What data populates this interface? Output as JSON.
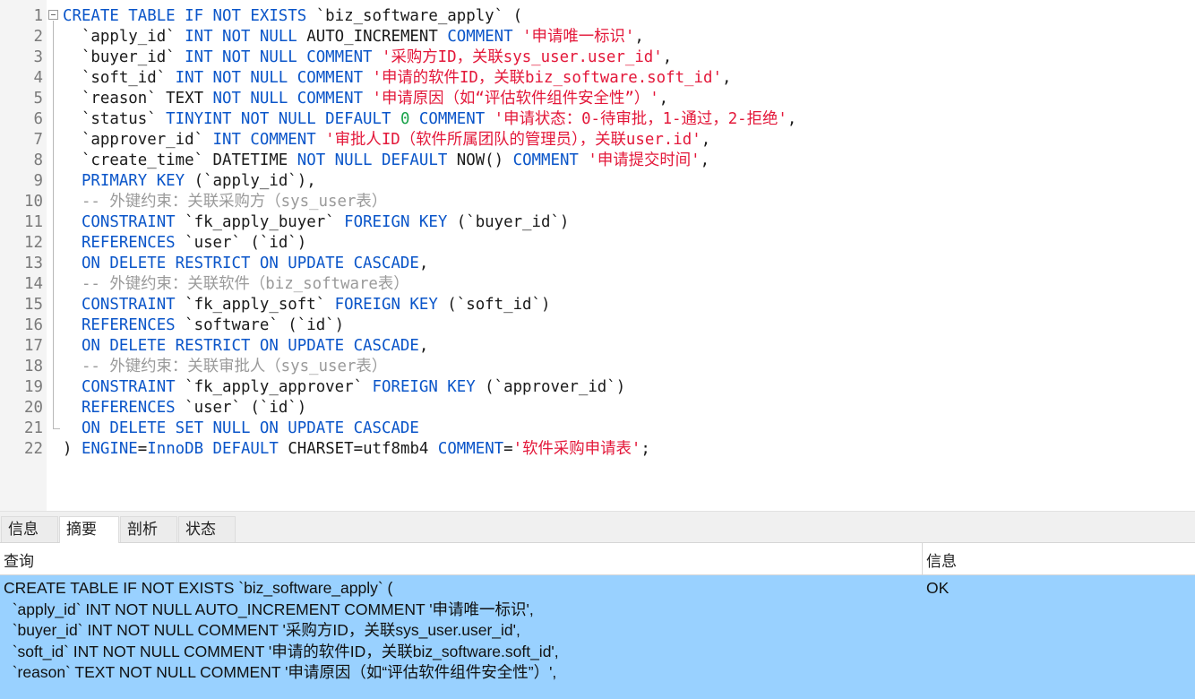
{
  "editor": {
    "lines": [
      {
        "n": "1",
        "tokens": [
          [
            "kw",
            "CREATE TABLE IF NOT EXISTS "
          ],
          [
            "id",
            "`biz_software_apply` ("
          ]
        ]
      },
      {
        "n": "2",
        "tokens": [
          [
            "id",
            "  `apply_id` "
          ],
          [
            "kw",
            "INT NOT NULL "
          ],
          [
            "id",
            "AUTO_INCREMENT "
          ],
          [
            "kw",
            "COMMENT "
          ],
          [
            "str",
            "'申请唯一标识'"
          ],
          [
            "id",
            ","
          ]
        ]
      },
      {
        "n": "3",
        "tokens": [
          [
            "id",
            "  `buyer_id` "
          ],
          [
            "kw",
            "INT NOT NULL COMMENT "
          ],
          [
            "str",
            "'采购方ID，关联sys_user.user_id'"
          ],
          [
            "id",
            ","
          ]
        ]
      },
      {
        "n": "4",
        "tokens": [
          [
            "id",
            "  `soft_id` "
          ],
          [
            "kw",
            "INT NOT NULL COMMENT "
          ],
          [
            "str",
            "'申请的软件ID，关联biz_software.soft_id'"
          ],
          [
            "id",
            ","
          ]
        ]
      },
      {
        "n": "5",
        "tokens": [
          [
            "id",
            "  `reason` TEXT "
          ],
          [
            "kw",
            "NOT NULL COMMENT "
          ],
          [
            "str",
            "'申请原因（如“评估软件组件安全性”）'"
          ],
          [
            "id",
            ","
          ]
        ]
      },
      {
        "n": "6",
        "tokens": [
          [
            "id",
            "  `status` "
          ],
          [
            "kw",
            "TINYINT NOT NULL DEFAULT "
          ],
          [
            "num",
            "0"
          ],
          [
            "kw",
            " COMMENT "
          ],
          [
            "str",
            "'申请状态：0-待审批，1-通过，2-拒绝'"
          ],
          [
            "id",
            ","
          ]
        ]
      },
      {
        "n": "7",
        "tokens": [
          [
            "id",
            "  `approver_id` "
          ],
          [
            "kw",
            "INT COMMENT "
          ],
          [
            "str",
            "'审批人ID（软件所属团队的管理员），关联user.id'"
          ],
          [
            "id",
            ","
          ]
        ]
      },
      {
        "n": "8",
        "tokens": [
          [
            "id",
            "  `create_time` DATETIME "
          ],
          [
            "kw",
            "NOT NULL DEFAULT "
          ],
          [
            "id",
            "NOW() "
          ],
          [
            "kw",
            "COMMENT "
          ],
          [
            "str",
            "'申请提交时间'"
          ],
          [
            "id",
            ","
          ]
        ]
      },
      {
        "n": "9",
        "tokens": [
          [
            "id",
            "  "
          ],
          [
            "kw",
            "PRIMARY KEY "
          ],
          [
            "id",
            "(`apply_id`),"
          ]
        ]
      },
      {
        "n": "10",
        "tokens": [
          [
            "cm",
            "  -- 外键约束：关联采购方（sys_user表）"
          ]
        ]
      },
      {
        "n": "11",
        "tokens": [
          [
            "id",
            "  "
          ],
          [
            "kw",
            "CONSTRAINT "
          ],
          [
            "id",
            "`fk_apply_buyer` "
          ],
          [
            "kw",
            "FOREIGN KEY "
          ],
          [
            "id",
            "(`buyer_id`)"
          ]
        ]
      },
      {
        "n": "12",
        "tokens": [
          [
            "id",
            "  "
          ],
          [
            "kw",
            "REFERENCES "
          ],
          [
            "id",
            "`user` (`id`)"
          ]
        ]
      },
      {
        "n": "13",
        "tokens": [
          [
            "id",
            "  "
          ],
          [
            "kw",
            "ON DELETE RESTRICT ON UPDATE CASCADE"
          ],
          [
            "id",
            ","
          ]
        ]
      },
      {
        "n": "14",
        "tokens": [
          [
            "cm",
            "  -- 外键约束：关联软件（biz_software表）"
          ]
        ]
      },
      {
        "n": "15",
        "tokens": [
          [
            "id",
            "  "
          ],
          [
            "kw",
            "CONSTRAINT "
          ],
          [
            "id",
            "`fk_apply_soft` "
          ],
          [
            "kw",
            "FOREIGN KEY "
          ],
          [
            "id",
            "(`soft_id`)"
          ]
        ]
      },
      {
        "n": "16",
        "tokens": [
          [
            "id",
            "  "
          ],
          [
            "kw",
            "REFERENCES "
          ],
          [
            "id",
            "`software` (`id`)"
          ]
        ]
      },
      {
        "n": "17",
        "tokens": [
          [
            "id",
            "  "
          ],
          [
            "kw",
            "ON DELETE RESTRICT ON UPDATE CASCADE"
          ],
          [
            "id",
            ","
          ]
        ]
      },
      {
        "n": "18",
        "tokens": [
          [
            "cm",
            "  -- 外键约束：关联审批人（sys_user表）"
          ]
        ]
      },
      {
        "n": "19",
        "tokens": [
          [
            "id",
            "  "
          ],
          [
            "kw",
            "CONSTRAINT "
          ],
          [
            "id",
            "`fk_apply_approver` "
          ],
          [
            "kw",
            "FOREIGN KEY "
          ],
          [
            "id",
            "(`approver_id`)"
          ]
        ]
      },
      {
        "n": "20",
        "tokens": [
          [
            "id",
            "  "
          ],
          [
            "kw",
            "REFERENCES "
          ],
          [
            "id",
            "`user` (`id`)"
          ]
        ]
      },
      {
        "n": "21",
        "tokens": [
          [
            "id",
            "  "
          ],
          [
            "kw",
            "ON DELETE SET NULL ON UPDATE CASCADE"
          ]
        ]
      },
      {
        "n": "22",
        "tokens": [
          [
            "id",
            ") "
          ],
          [
            "kw",
            "ENGINE"
          ],
          [
            "id",
            "="
          ],
          [
            "kw",
            "InnoDB DEFAULT "
          ],
          [
            "id",
            "CHARSET=utf8mb4 "
          ],
          [
            "kw",
            "COMMENT"
          ],
          [
            "id",
            "="
          ],
          [
            "str",
            "'软件采购申请表'"
          ],
          [
            "id",
            ";"
          ]
        ]
      }
    ]
  },
  "colors": {
    "keyword": "#0a55c9",
    "string": "#e3183a",
    "number": "#1aa34a",
    "comment": "#9a9a9a",
    "selected_row": "#99d1ff"
  },
  "tabs": [
    {
      "label": "信息",
      "active": false
    },
    {
      "label": "摘要",
      "active": true
    },
    {
      "label": "剖析",
      "active": false
    },
    {
      "label": "状态",
      "active": false
    }
  ],
  "result": {
    "columns": {
      "query": "查询",
      "info": "信息"
    },
    "query_lines": [
      "CREATE TABLE IF NOT EXISTS `biz_software_apply` (",
      "  `apply_id` INT NOT NULL AUTO_INCREMENT COMMENT '申请唯一标识',",
      "  `buyer_id` INT NOT NULL COMMENT '采购方ID，关联sys_user.user_id',",
      "  `soft_id` INT NOT NULL COMMENT '申请的软件ID，关联biz_software.soft_id',",
      "  `reason` TEXT NOT NULL COMMENT '申请原因（如“评估软件组件安全性”）',"
    ],
    "info_value": "OK"
  }
}
